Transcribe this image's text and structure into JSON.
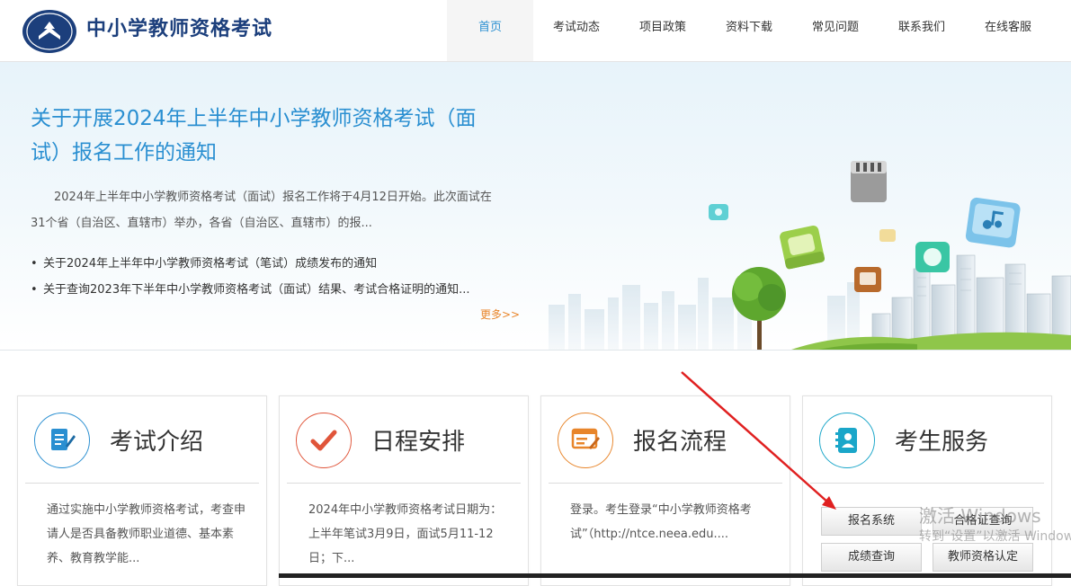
{
  "header": {
    "site_title": "中小学教师资格考试",
    "nav": [
      {
        "label": "首页",
        "active": true
      },
      {
        "label": "考试动态"
      },
      {
        "label": "项目政策"
      },
      {
        "label": "资料下载"
      },
      {
        "label": "常见问题"
      },
      {
        "label": "联系我们"
      },
      {
        "label": "在线客服"
      }
    ]
  },
  "banner": {
    "title": "关于开展2024年上半年中小学教师资格考试（面试）报名工作的通知",
    "description": "2024年上半年中小学教师资格考试（面试）报名工作将于4月12日开始。此次面试在31个省（自治区、直辖市）举办，各省（自治区、直辖市）的报...",
    "news": [
      {
        "bullet": "•",
        "text": "关于2024年上半年中小学教师资格考试（笔试）成绩发布的通知"
      },
      {
        "bullet": "•",
        "text": "关于查询2023年下半年中小学教师资格考试（面试）结果、考试合格证明的通知..."
      }
    ],
    "more": "更多>>"
  },
  "cards": [
    {
      "title": "考试介绍",
      "text": "通过实施中小学教师资格考试，考查申请人是否具备教师职业道德、基本素养、教育教学能...",
      "icon": "document-pen-icon",
      "color": "#2a8fd1"
    },
    {
      "title": "日程安排",
      "text": "2024年中小学教师资格考试日期为：上半年笔试3月9日，面试5月11-12日；下...",
      "icon": "checkmark-icon",
      "color": "#e0553a"
    },
    {
      "title": "报名流程",
      "text": "登录。考生登录“中小学教师资格考试”（http://ntce.neea.edu....",
      "icon": "form-pen-icon",
      "color": "#e8852a"
    },
    {
      "title": "考生服务",
      "icon": "address-book-icon",
      "color": "#1aa6c9"
    }
  ],
  "services": {
    "registration": "报名系统",
    "certificate_query": "合格证查询",
    "score_query": "成绩查询",
    "qualification": "教师资格认定"
  },
  "watermark": {
    "line1": "激活 Windows",
    "line2": "转到“设置”以激活 Windows。"
  }
}
